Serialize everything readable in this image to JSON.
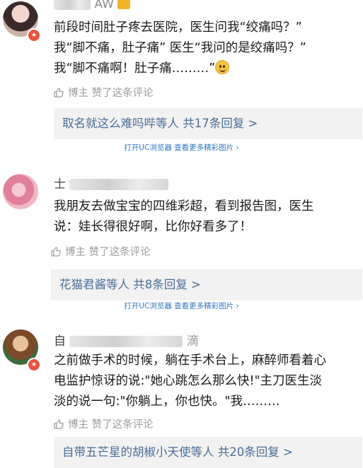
{
  "comments": [
    {
      "username_visible": "AW",
      "text_lines": [
        "前段时间肚子疼去医院，医生问我“绞痛吗？”",
        "我“脚不痛，肚子痛” 医生“我问的是绞痛吗？”",
        "我“脚不痛啊！肚子痛………”"
      ],
      "like_text": "博主 赞了这条评论",
      "reply_text": "取名就这么难吗哔等人 共17条回复 >"
    },
    {
      "username_visible": "士",
      "text_lines": [
        "我朋友去做宝宝的四维彩超，看到报告图，医生",
        "说：娃长得很好啊，比你好看多了！"
      ],
      "like_text": "博主 赞了这条评论",
      "reply_text": "花猫君酱等人 共8条回复 >"
    },
    {
      "username_visible": "自",
      "username_suffix": "滴",
      "text_lines": [
        "之前做手术的时候，躺在手术台上，麻醉师看着心",
        "电监护惊讶的说:\"她心跳怎么那么快!\"主刀医生淡",
        "淡的说一句:\"你躺上，你也快。\"我………"
      ],
      "like_text": "博主 赞了这条评论",
      "reply_text": "自带五芒星的胡椒小天使等人 共20条回复 >"
    }
  ],
  "promo_text": "打开UC浏览器 查看更多精彩图片 ›",
  "colors": {
    "link": "#4a6d98",
    "promo": "#2d76c5",
    "badge": "#e8533f",
    "reply_bg": "#f2f2f2"
  }
}
